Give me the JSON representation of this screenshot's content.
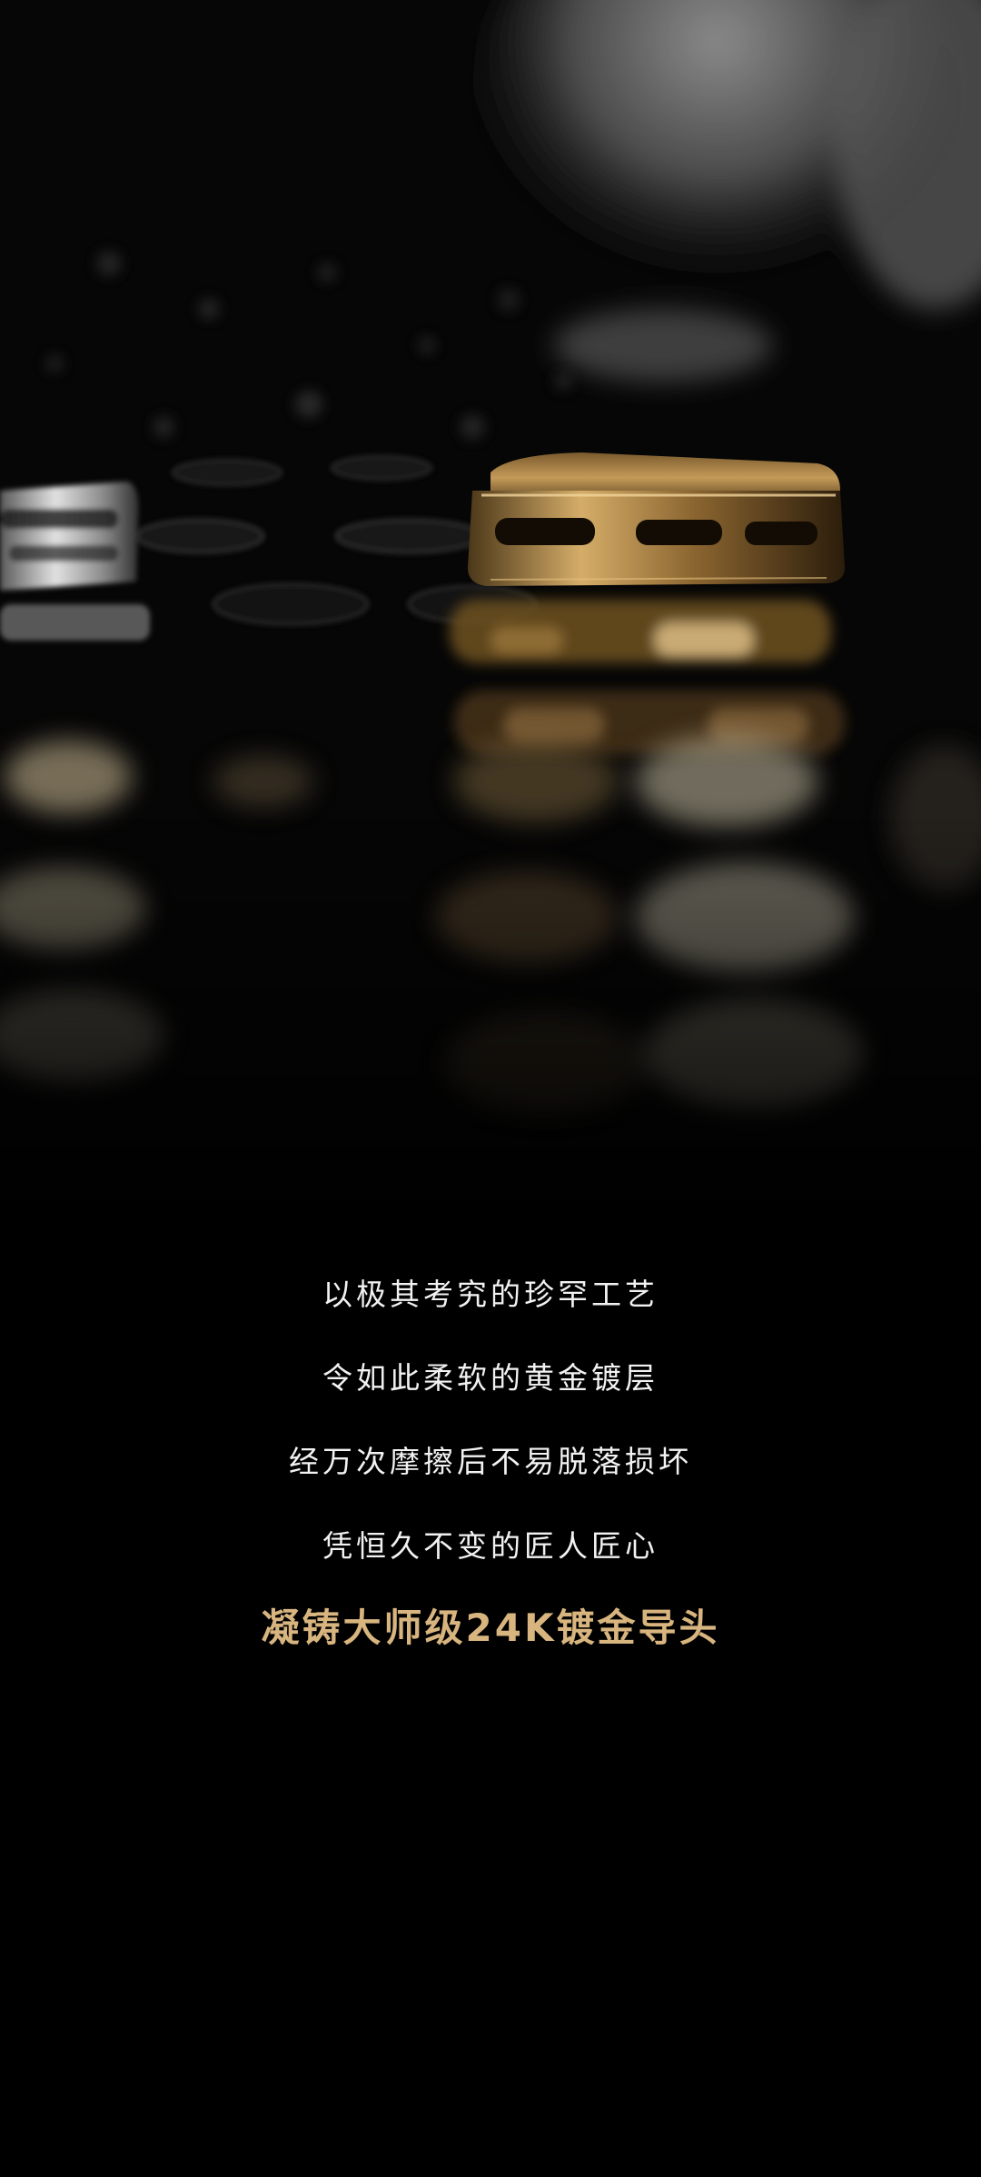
{
  "copy": {
    "lines": [
      "以极其考究的珍罕工艺",
      "令如此柔软的黄金镀层",
      "经万次摩擦后不易脱落损坏",
      "凭恒久不变的匠人匠心"
    ],
    "headline": "凝铸大师级24K镀金导头"
  },
  "colors": {
    "background": "#000000",
    "body_text": "#f2f2f2",
    "headline": "#d8b57f",
    "gold": "#c49a58",
    "silver": "#d8d8d8"
  },
  "photo": {
    "subject": "gold and silver connector plugs on a dark surface with a hand above"
  }
}
